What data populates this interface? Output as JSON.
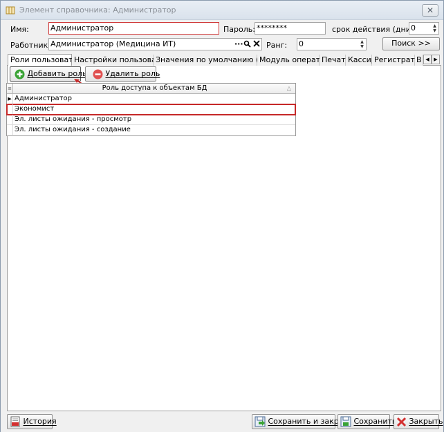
{
  "window": {
    "title": "Элемент справочника: Администратор"
  },
  "form": {
    "name_label": "Имя:",
    "name_value": "Администратор",
    "password_label": "Пароль:",
    "password_value": "********",
    "expiry_label": "срок действия (дни):",
    "expiry_value": "0",
    "employee_label": "Работник:",
    "employee_value": "Администратор (Медицина ИТ)",
    "employee_more": "···",
    "rank_label": "Ранг:",
    "rank_value": "0",
    "search_button": "Поиск  >>"
  },
  "tabs": [
    {
      "label": "Роли пользователя",
      "active": true
    },
    {
      "label": "Настройки пользователя"
    },
    {
      "label": "Значения по умолчанию (общие)"
    },
    {
      "label": "Модуль оператора"
    },
    {
      "label": "Печать"
    },
    {
      "label": "Кассир"
    },
    {
      "label": "Регистратор"
    },
    {
      "label": "В"
    }
  ],
  "toolbar": {
    "add_role": "Добавить роль",
    "delete_role": "Удалить роль"
  },
  "grid": {
    "column": "Роль доступа к объектам БД",
    "rows": [
      "Администратор",
      "Экономист",
      "Эл. листы ожидания - просмотр",
      "Эл. листы ожидания - создание"
    ],
    "selected_index": 1
  },
  "footer": {
    "history": "История",
    "save_and_close": "Сохранить и закрыть",
    "save": "Сохранить",
    "close": "Закрыть"
  },
  "colors": {
    "highlight_red": "#c62828",
    "add_green": "#3aa335",
    "delete_red": "#e05050"
  }
}
